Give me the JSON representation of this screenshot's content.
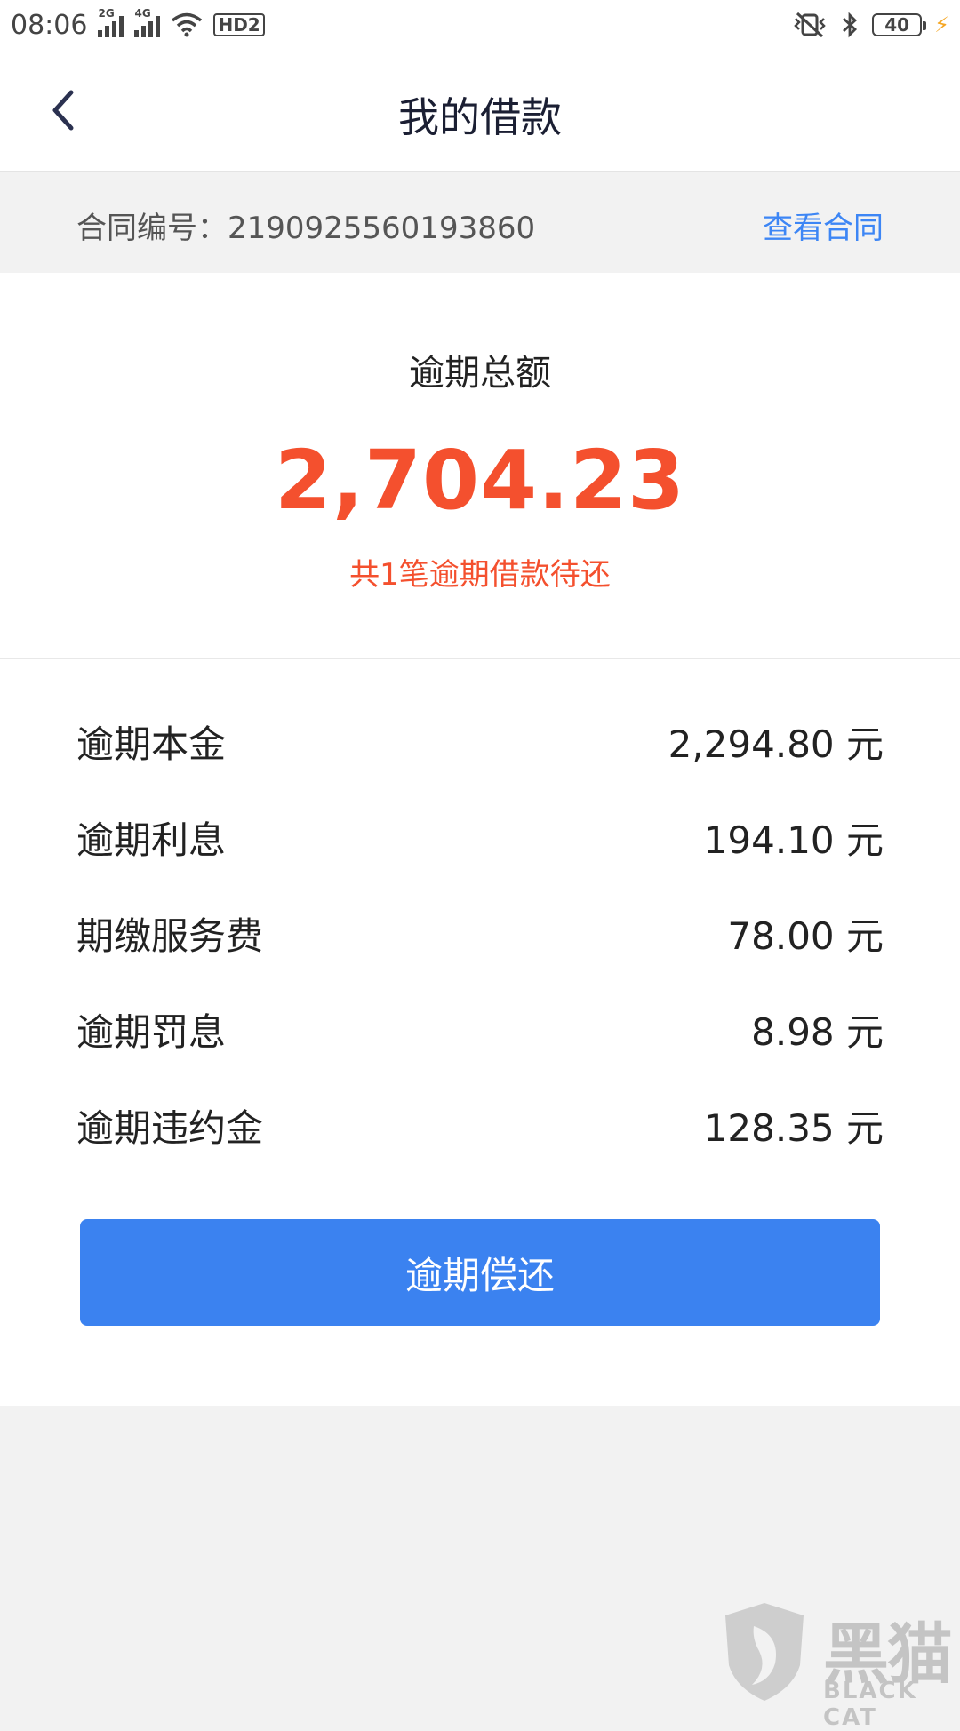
{
  "status_bar": {
    "time": "08:06",
    "net1": "2G",
    "net2": "4G",
    "hd": "HD2",
    "battery": "40"
  },
  "header": {
    "title": "我的借款"
  },
  "contract": {
    "label": "合同编号：2190925560193860",
    "link": "查看合同"
  },
  "summary": {
    "title": "逾期总额",
    "amount": "2,704.23",
    "note": "共1笔逾期借款待还"
  },
  "details": [
    {
      "label": "逾期本金",
      "value": "2,294.80 元"
    },
    {
      "label": "逾期利息",
      "value": "194.10 元"
    },
    {
      "label": "期缴服务费",
      "value": "78.00 元"
    },
    {
      "label": "逾期罚息",
      "value": "8.98 元"
    },
    {
      "label": "逾期违约金",
      "value": "128.35 元"
    }
  ],
  "action": {
    "repay_label": "逾期偿还"
  },
  "watermark": {
    "cn": "黑猫",
    "en": "BLACK CAT"
  },
  "colors": {
    "accent": "#3b82f0",
    "link": "#3d86f5",
    "overdue": "#f4502e"
  }
}
